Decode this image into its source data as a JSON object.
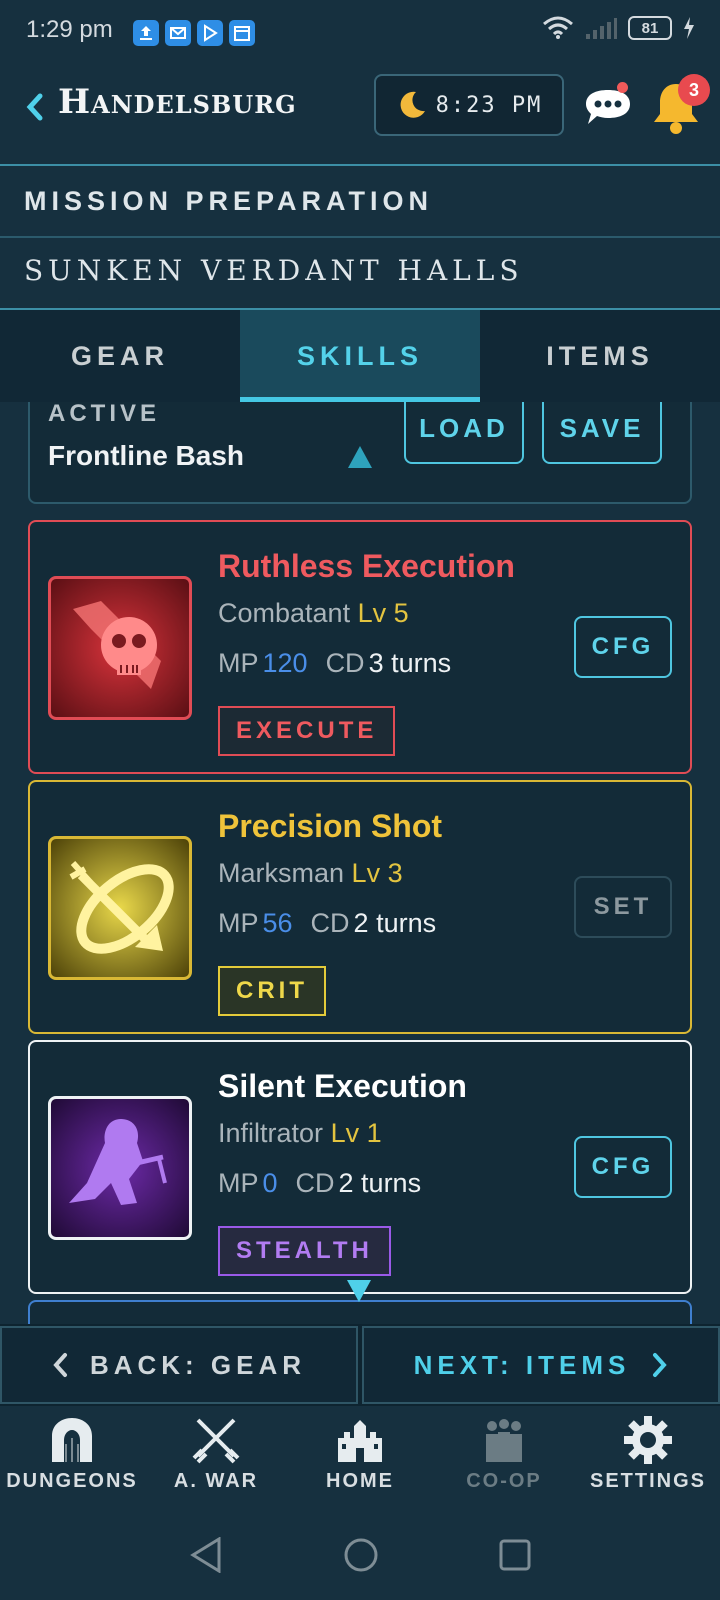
{
  "status_bar": {
    "time": "1:29 pm",
    "battery": "81"
  },
  "header": {
    "title": "Handelsburg",
    "clock": "8:23 PM",
    "notification_count": "3"
  },
  "section": {
    "mission_label": "MISSION PREPARATION",
    "dungeon_name": "SUNKEN VERDANT HALLS"
  },
  "tabs": [
    {
      "label": "GEAR",
      "active": false
    },
    {
      "label": "SKILLS",
      "active": true
    },
    {
      "label": "ITEMS",
      "active": false
    }
  ],
  "loadout": {
    "label": "ACTIVE",
    "value": "Frontline Bash",
    "load_label": "LOAD",
    "save_label": "SAVE"
  },
  "skills": [
    {
      "name": "Ruthless Execution",
      "class": "Combatant",
      "level": "Lv 5",
      "mp_label": "MP",
      "mp": "120",
      "cd_label": "CD",
      "cd": "3 turns",
      "tag": "EXECUTE",
      "button": "CFG",
      "accent": "#e04c55",
      "icon": "skull-icon"
    },
    {
      "name": "Precision Shot",
      "class": "Marksman",
      "level": "Lv 3",
      "mp_label": "MP",
      "mp": "56",
      "cd_label": "CD",
      "cd": "2 turns",
      "tag": "CRIT",
      "button": "SET",
      "accent": "#d9b835",
      "icon": "arrow-target-icon"
    },
    {
      "name": "Silent Execution",
      "class": "Infiltrator",
      "level": "Lv 1",
      "mp_label": "MP",
      "mp": "0",
      "cd_label": "CD",
      "cd": "2 turns",
      "tag": "STEALTH",
      "button": "CFG",
      "accent": "#9a5ae8",
      "icon": "hooded-assassin-icon"
    }
  ],
  "footer_nav": {
    "back": "BACK: GEAR",
    "next": "NEXT: ITEMS"
  },
  "bottom_nav": [
    {
      "label": "DUNGEONS",
      "icon": "dungeon-gate-icon"
    },
    {
      "label": "A. WAR",
      "icon": "crossed-swords-icon"
    },
    {
      "label": "HOME",
      "icon": "castle-icon"
    },
    {
      "label": "CO-OP",
      "icon": "group-icon",
      "disabled": true
    },
    {
      "label": "SETTINGS",
      "icon": "gear-icon"
    }
  ],
  "colors": {
    "background": "#16303f",
    "accent": "#4fd0ea",
    "danger": "#e04c55",
    "gold": "#d9b835",
    "purple": "#9a5ae8"
  }
}
